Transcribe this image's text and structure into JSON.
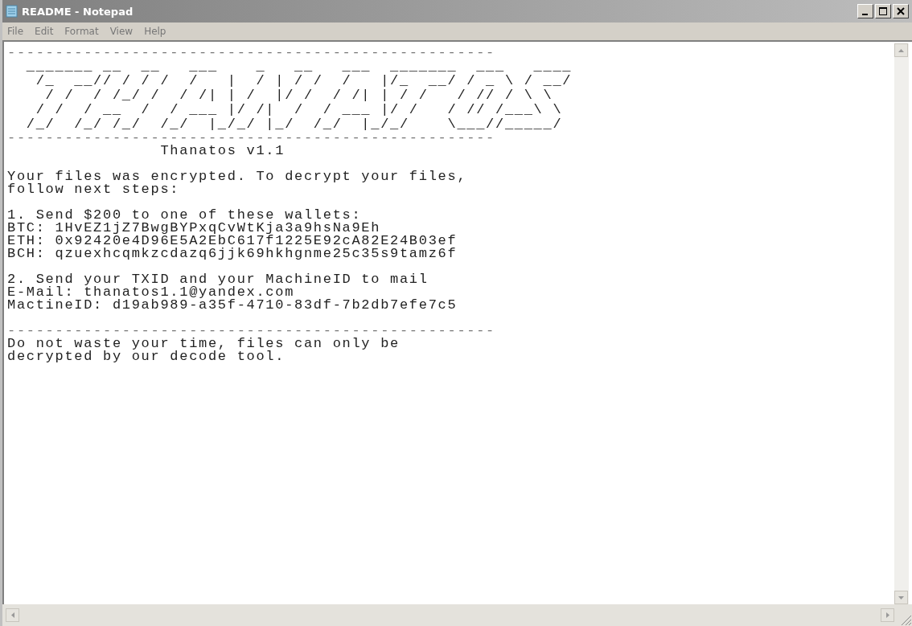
{
  "window": {
    "title": "README - Notepad"
  },
  "menu": [
    "File",
    "Edit",
    "Format",
    "View",
    "Help"
  ],
  "document": [
    {
      "kind": "rule",
      "lines": [
        "---------------------------------------------------"
      ]
    },
    {
      "kind": "art",
      "lines": [
        "  _______ __  __   ___    _   __   ___  _______  ___   ____",
        "   /_  __// / / /  /   |  / | / /  /   |/_  __/ / _ \\ / __/",
        "    / /  / /_/ /  / /| | /  |/ /  / /| | / /   / // / \\ \\  ",
        "   / /  / __  /  / ___ |/ /|  /  / ___ |/ /   / // /___\\ \\ ",
        "  /_/  /_/ /_/  /_/  |_/_/ |_/  /_/  |_/_/    \\___//_____/ "
      ]
    },
    {
      "kind": "rule",
      "lines": [
        "---------------------------------------------------"
      ]
    },
    {
      "kind": "text",
      "lines": [
        "                Thanatos v1.1"
      ]
    },
    {
      "kind": "blank"
    },
    {
      "kind": "text",
      "lines": [
        "Your files was encrypted. To decrypt your files,",
        "follow next steps:"
      ]
    },
    {
      "kind": "blank"
    },
    {
      "kind": "text",
      "lines": [
        "1. Send $200 to one of these wallets:",
        "BTC: 1HvEZ1jZ7BwgBYPxqCvWtKja3a9hsNa9Eh",
        "ETH: 0x92420e4D96E5A2EbC617f1225E92cA82E24B03ef",
        "BCH: qzuexhcqmkzcdazq6jjk69hkhgnme25c35s9tamz6f"
      ]
    },
    {
      "kind": "blank"
    },
    {
      "kind": "text",
      "lines": [
        "2. Send your TXID and your MachineID to mail",
        "E-Mail: thanatos1.1@yandex.com",
        "MactineID: d19ab989-a35f-4710-83df-7b2db7efe7c5"
      ]
    },
    {
      "kind": "blank"
    },
    {
      "kind": "rule",
      "lines": [
        "---------------------------------------------------"
      ]
    },
    {
      "kind": "text",
      "lines": [
        "Do not waste your time, files can only be",
        "decrypted by our decode tool."
      ]
    }
  ]
}
